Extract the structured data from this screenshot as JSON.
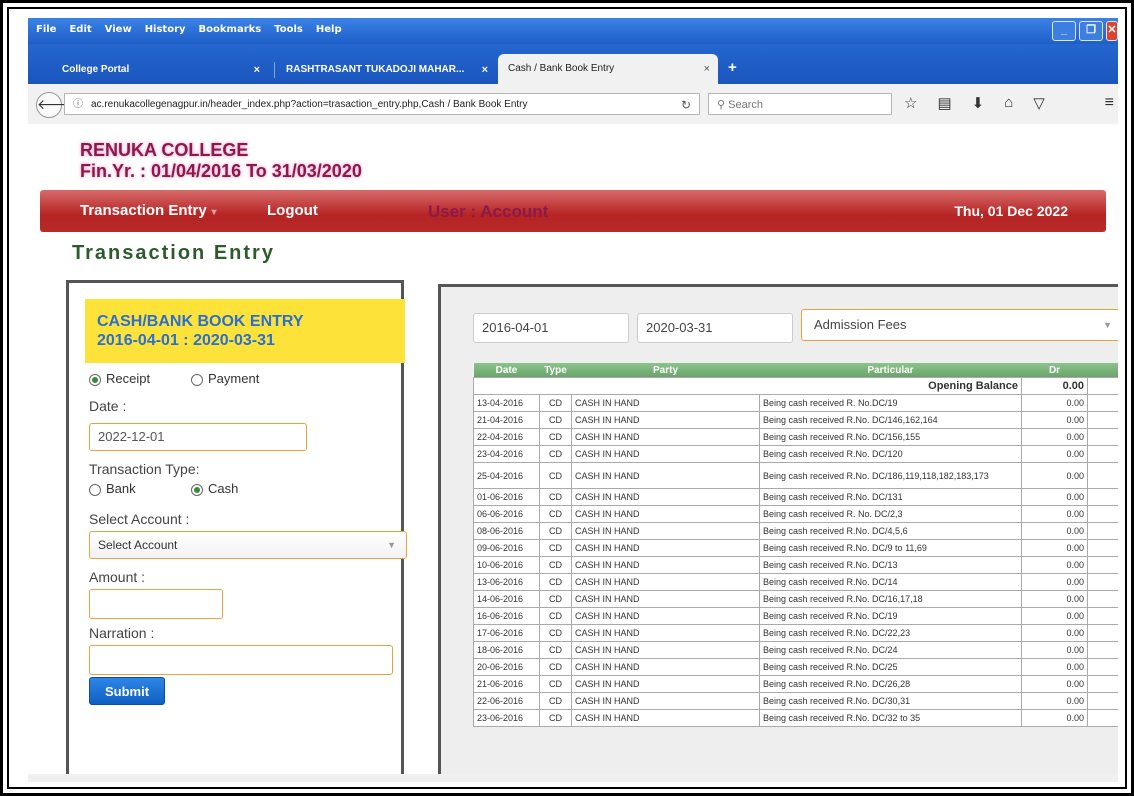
{
  "browser": {
    "menu": [
      "File",
      "Edit",
      "View",
      "History",
      "Bookmarks",
      "Tools",
      "Help"
    ],
    "tabs": [
      {
        "title": "College Portal",
        "close": "×"
      },
      {
        "title": "RASHTRASANT TUKADOJI MAHAR...",
        "close": "×"
      },
      {
        "title": "Cash / Bank Book Entry",
        "close": "×",
        "active": true
      }
    ],
    "new_tab": "+",
    "url": "ac.renukacollegenagpur.in/header_index.php?action=trasaction_entry.php,Cash / Bank Book Entry",
    "search_placeholder": "Search"
  },
  "header": {
    "college": "RENUKA COLLEGE",
    "fin_year": "Fin.Yr. : 01/04/2016 To 31/03/2020",
    "nav_transaction": "Transaction Entry",
    "nav_logout": "Logout",
    "user": "User : Account",
    "date": "Thu, 01 Dec 2022"
  },
  "page_title": "Transaction Entry",
  "form": {
    "heading_line1": "CASH/BANK BOOK ENTRY",
    "heading_line2": "2016-04-01 : 2020-03-31",
    "receipt_label": "Receipt",
    "payment_label": "Payment",
    "date_label": "Date :",
    "date_value": "2022-12-01",
    "txn_type_label": "Transaction Type:",
    "bank_label": "Bank",
    "cash_label": "Cash",
    "account_label": "Select Account :",
    "account_selected": "Select Account",
    "amount_label": "Amount :",
    "amount_value": "",
    "narration_label": "Narration :",
    "narration_value": "",
    "submit_label": "Submit"
  },
  "filters": {
    "from_date": "2016-04-01",
    "to_date": "2020-03-31",
    "account": "Admission Fees"
  },
  "table": {
    "columns": [
      "Date",
      "Type",
      "Party",
      "Particular",
      "Dr"
    ],
    "opening_label": "Opening Balance",
    "opening_dr": "0.00",
    "rows": [
      {
        "date": "13-04-2016",
        "type": "CD",
        "party": "CASH IN HAND",
        "particular": "Being cash received R. No.DC/19",
        "dr": "0.00"
      },
      {
        "date": "21-04-2016",
        "type": "CD",
        "party": "CASH IN HAND",
        "particular": "Being cash received R.No. DC/146,162,164",
        "dr": "0.00"
      },
      {
        "date": "22-04-2016",
        "type": "CD",
        "party": "CASH IN HAND",
        "particular": "Being cash received R.No. DC/156,155",
        "dr": "0.00"
      },
      {
        "date": "23-04-2016",
        "type": "CD",
        "party": "CASH IN HAND",
        "particular": "Being cash received R.No. DC/120",
        "dr": "0.00"
      },
      {
        "date": "25-04-2016",
        "type": "CD",
        "party": "CASH IN HAND",
        "particular": "Being cash received R.No. DC/186,119,118,182,183,173",
        "dr": "0.00"
      },
      {
        "date": "01-06-2016",
        "type": "CD",
        "party": "CASH IN HAND",
        "particular": "Being cash received R.No. DC/131",
        "dr": "0.00"
      },
      {
        "date": "06-06-2016",
        "type": "CD",
        "party": "CASH IN HAND",
        "particular": "Being cash received R. No. DC/2,3",
        "dr": "0.00"
      },
      {
        "date": "08-06-2016",
        "type": "CD",
        "party": "CASH IN HAND",
        "particular": "Being cash received R.No. DC/4,5,6",
        "dr": "0.00"
      },
      {
        "date": "09-06-2016",
        "type": "CD",
        "party": "CASH IN HAND",
        "particular": "Being cash received R.No. DC/9 to 11,69",
        "dr": "0.00"
      },
      {
        "date": "10-06-2016",
        "type": "CD",
        "party": "CASH IN HAND",
        "particular": "Being cash received R.No. DC/13",
        "dr": "0.00"
      },
      {
        "date": "13-06-2016",
        "type": "CD",
        "party": "CASH IN HAND",
        "particular": "Being cash received R.No. DC/14",
        "dr": "0.00"
      },
      {
        "date": "14-06-2016",
        "type": "CD",
        "party": "CASH IN HAND",
        "particular": "Being cash received R.No. DC/16,17,18",
        "dr": "0.00"
      },
      {
        "date": "16-06-2016",
        "type": "CD",
        "party": "CASH IN HAND",
        "particular": "Being cash received R.No. DC/19",
        "dr": "0.00"
      },
      {
        "date": "17-06-2016",
        "type": "CD",
        "party": "CASH IN HAND",
        "particular": "Being cash received R.No. DC/22,23",
        "dr": "0.00"
      },
      {
        "date": "18-06-2016",
        "type": "CD",
        "party": "CASH IN HAND",
        "particular": "Being cash received R.No. DC/24",
        "dr": "0.00"
      },
      {
        "date": "20-06-2016",
        "type": "CD",
        "party": "CASH IN HAND",
        "particular": "Being cash received R.No. DC/25",
        "dr": "0.00"
      },
      {
        "date": "21-06-2016",
        "type": "CD",
        "party": "CASH IN HAND",
        "particular": "Being cash received R.No. DC/26,28",
        "dr": "0.00"
      },
      {
        "date": "22-06-2016",
        "type": "CD",
        "party": "CASH IN HAND",
        "particular": "Being cash received R.No. DC/30,31",
        "dr": "0.00"
      },
      {
        "date": "23-06-2016",
        "type": "CD",
        "party": "CASH IN HAND",
        "particular": "Being cash received R.No. DC/32 to 35",
        "dr": "0.00"
      }
    ]
  }
}
